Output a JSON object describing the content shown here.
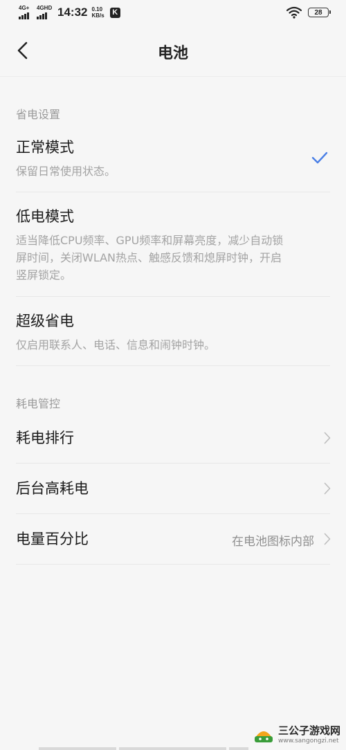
{
  "status_bar": {
    "network_1": "4G+",
    "network_2": "4GHD",
    "time": "14:32",
    "speed_value": "0.10",
    "speed_unit": "KB/s",
    "app_badge": "K",
    "battery_level": "28"
  },
  "header": {
    "title": "电池"
  },
  "power_saving": {
    "section_label": "省电设置",
    "modes": [
      {
        "title": "正常模式",
        "desc": "保留日常使用状态。",
        "selected": true
      },
      {
        "title": "低电模式",
        "desc": "适当降低CPU频率、GPU频率和屏幕亮度，减少自动锁屏时间，关闭WLAN热点、触感反馈和熄屏时钟，开启竖屏锁定。",
        "selected": false
      },
      {
        "title": "超级省电",
        "desc": "仅启用联系人、电话、信息和闹钟时钟。",
        "selected": false
      }
    ]
  },
  "power_control": {
    "section_label": "耗电管控",
    "items": [
      {
        "title": "耗电排行",
        "value": ""
      },
      {
        "title": "后台高耗电",
        "value": ""
      },
      {
        "title": "电量百分比",
        "value": "在电池图标内部"
      }
    ]
  },
  "watermark": {
    "name": "三公子游戏网",
    "url": "www.sangongzi.net"
  },
  "colors": {
    "accent": "#4a7fe6",
    "background": "#f6f6f6",
    "title_text": "#1a1a1a",
    "desc_text": "#a3a3a3"
  }
}
